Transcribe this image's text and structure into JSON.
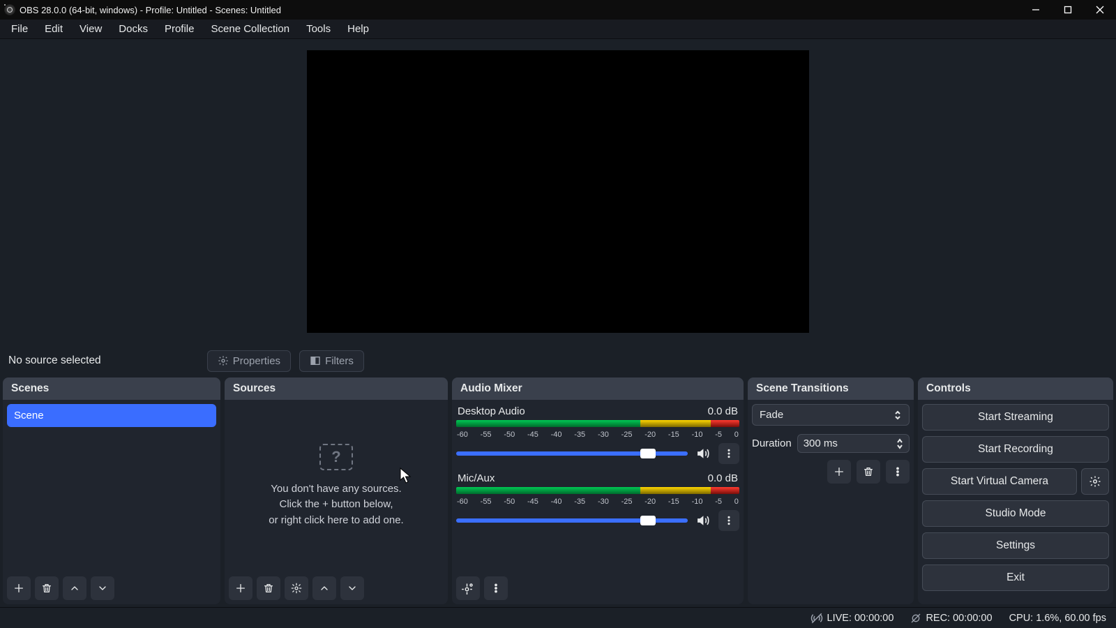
{
  "titlebar": {
    "text": "OBS 28.0.0 (64-bit, windows) - Profile: Untitled - Scenes: Untitled"
  },
  "menu": [
    "File",
    "Edit",
    "View",
    "Docks",
    "Profile",
    "Scene Collection",
    "Tools",
    "Help"
  ],
  "contextbar": {
    "status": "No source selected",
    "properties": "Properties",
    "filters": "Filters"
  },
  "docks": {
    "scenes": {
      "title": "Scenes",
      "items": [
        "Scene"
      ]
    },
    "sources": {
      "title": "Sources",
      "empty": {
        "line1": "You don't have any sources.",
        "line2": "Click the + button below,",
        "line3": "or right click here to add one."
      },
      "ghost": "?"
    },
    "mixer": {
      "title": "Audio Mixer",
      "ticks": [
        "-60",
        "-55",
        "-50",
        "-45",
        "-40",
        "-35",
        "-30",
        "-25",
        "-20",
        "-15",
        "-10",
        "-5",
        "0"
      ],
      "channels": [
        {
          "name": "Desktop Audio",
          "db": "0.0 dB"
        },
        {
          "name": "Mic/Aux",
          "db": "0.0 dB"
        }
      ]
    },
    "transitions": {
      "title": "Scene Transitions",
      "selected": "Fade",
      "duration_label": "Duration",
      "duration_value": "300 ms"
    },
    "controls": {
      "title": "Controls",
      "start_streaming": "Start Streaming",
      "start_recording": "Start Recording",
      "virtual_cam": "Start Virtual Camera",
      "studio": "Studio Mode",
      "settings": "Settings",
      "exit": "Exit"
    }
  },
  "status": {
    "live": "LIVE: 00:00:00",
    "rec": "REC: 00:00:00",
    "cpu": "CPU: 1.6%, 60.00 fps"
  }
}
